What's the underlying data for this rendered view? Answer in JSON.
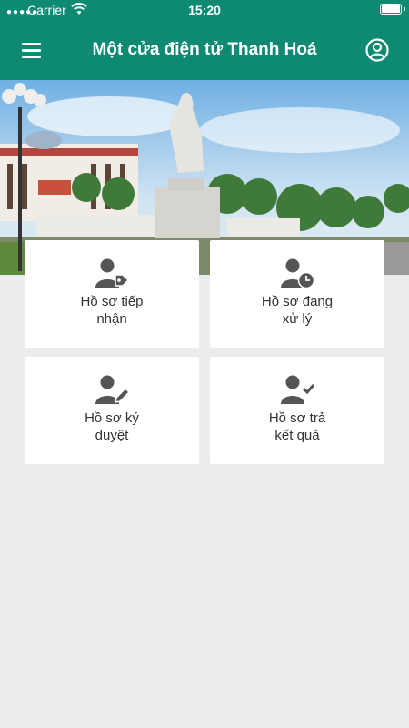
{
  "status_bar": {
    "carrier": "Carrier",
    "time": "15:20"
  },
  "header": {
    "title": "Một cửa điện tử Thanh Hoá",
    "background_color": "#0e8a72",
    "menu_icon": "hamburger-menu-icon",
    "profile_icon": "user-circle-icon"
  },
  "hero": {
    "image": "photo of Thanh Hoa square with statue and government building"
  },
  "cards": [
    {
      "label_line1": "Hồ sơ tiếp",
      "label_line2": "nhận",
      "icon": "user-tag-icon"
    },
    {
      "label_line1": "Hồ sơ đang",
      "label_line2": "xử lý",
      "icon": "user-clock-icon"
    },
    {
      "label_line1": "Hồ sơ ký",
      "label_line2": "duyệt",
      "icon": "user-edit-icon"
    },
    {
      "label_line1": "Hồ sơ trả",
      "label_line2": "kết quả",
      "icon": "user-check-icon"
    }
  ]
}
